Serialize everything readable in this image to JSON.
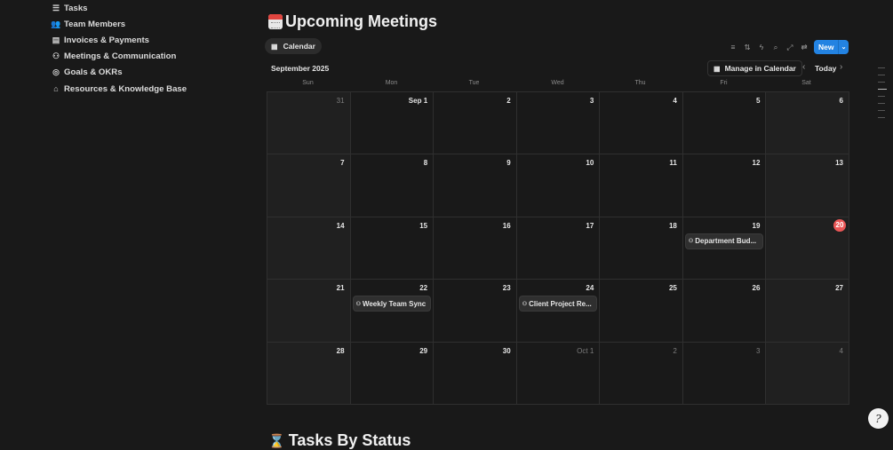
{
  "sidebar": {
    "items": [
      {
        "label": "Tasks",
        "icon": "checklist-icon",
        "glyph": "☰"
      },
      {
        "label": "Team Members",
        "icon": "people-icon",
        "glyph": "👥"
      },
      {
        "label": "Invoices & Payments",
        "icon": "receipt-icon",
        "glyph": "▤"
      },
      {
        "label": "Meetings & Communication",
        "icon": "group-icon",
        "glyph": "⚇"
      },
      {
        "label": "Goals & OKRs",
        "icon": "target-icon",
        "glyph": "◎"
      },
      {
        "label": "Resources & Knowledge Base",
        "icon": "bank-icon",
        "glyph": "⌂"
      }
    ]
  },
  "page": {
    "title": "Upcoming Meetings",
    "section2_title": "Tasks By Status"
  },
  "view": {
    "tab_label": "Calendar"
  },
  "toolbar": {
    "icons": [
      {
        "name": "filter-icon",
        "glyph": "≡"
      },
      {
        "name": "sort-icon",
        "glyph": "⇅"
      },
      {
        "name": "automation-icon",
        "glyph": "ϟ"
      },
      {
        "name": "search-icon",
        "glyph": "⌕"
      },
      {
        "name": "expand-icon",
        "glyph": "⤢"
      },
      {
        "name": "settings-icon",
        "glyph": "⇄"
      }
    ],
    "new_label": "New",
    "new_dropdown": "⌄"
  },
  "calendar": {
    "month_label": "September 2025",
    "manage_label": "Manage in Calendar",
    "today_label": "Today",
    "prev": "‹",
    "next": "›",
    "weekdays": [
      "Sun",
      "Mon",
      "Tue",
      "Wed",
      "Thu",
      "Fri",
      "Sat"
    ],
    "days": [
      {
        "label": "31",
        "muted": true
      },
      {
        "label": "Sep 1"
      },
      {
        "label": "2"
      },
      {
        "label": "3"
      },
      {
        "label": "4"
      },
      {
        "label": "5"
      },
      {
        "label": "6"
      },
      {
        "label": "7"
      },
      {
        "label": "8"
      },
      {
        "label": "9"
      },
      {
        "label": "10"
      },
      {
        "label": "11"
      },
      {
        "label": "12"
      },
      {
        "label": "13"
      },
      {
        "label": "14"
      },
      {
        "label": "15"
      },
      {
        "label": "16"
      },
      {
        "label": "17"
      },
      {
        "label": "18"
      },
      {
        "label": "19",
        "event": "Department Bud..."
      },
      {
        "label": "20",
        "today": true
      },
      {
        "label": "21"
      },
      {
        "label": "22",
        "event": "Weekly Team Sync"
      },
      {
        "label": "23"
      },
      {
        "label": "24",
        "event": "Client Project Re..."
      },
      {
        "label": "25"
      },
      {
        "label": "26"
      },
      {
        "label": "27"
      },
      {
        "label": "28"
      },
      {
        "label": "29"
      },
      {
        "label": "30"
      },
      {
        "label": "Oct 1",
        "muted": true
      },
      {
        "label": "2",
        "muted": true
      },
      {
        "label": "3",
        "muted": true
      },
      {
        "label": "4",
        "muted": true
      }
    ]
  },
  "help": {
    "glyph": "?"
  }
}
